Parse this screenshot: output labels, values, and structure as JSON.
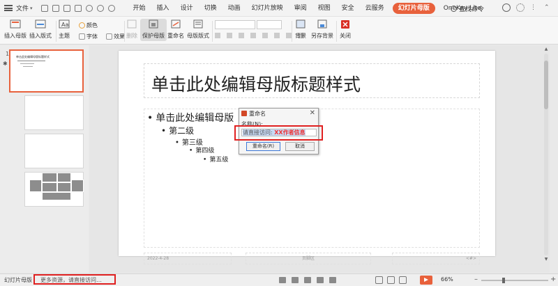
{
  "menubar": {
    "file_label": "文件",
    "tabs": [
      {
        "label": "开始",
        "active": false
      },
      {
        "label": "插入",
        "active": false
      },
      {
        "label": "设计",
        "active": false
      },
      {
        "label": "切换",
        "active": false
      },
      {
        "label": "动画",
        "active": false
      },
      {
        "label": "幻灯片放映",
        "active": false
      },
      {
        "label": "审阅",
        "active": false
      },
      {
        "label": "视图",
        "active": false
      },
      {
        "label": "安全",
        "active": false
      },
      {
        "label": "云服务",
        "active": false
      },
      {
        "label": "幻灯片母版",
        "active": true
      },
      {
        "label": "OneKey Lite",
        "active": false
      }
    ],
    "search_label": "查找命令"
  },
  "ribbon": {
    "insert_master": "插入母版",
    "insert_layout": "插入版式",
    "theme": "主题",
    "color": "颜色",
    "font": "字体",
    "effect": "效果",
    "delete": "删除",
    "protect_master": "保护母版",
    "rename": "重命名",
    "master_layout": "母版版式",
    "background": "背景",
    "save_bg": "另存背景",
    "close": "关闭"
  },
  "thumbnails": {
    "index": "1",
    "master_title": "单击此处编辑母版标题样式"
  },
  "slide": {
    "title": "单击此处编辑母版标题样式",
    "levels": [
      "单击此处编辑母版",
      "第二级",
      "第三级",
      "第四级",
      "第五级"
    ],
    "footer_date": "2022-4-28",
    "footer_center": "页脚区",
    "footer_num": "<#>"
  },
  "dialog": {
    "title": "重命名",
    "label": "名称(N):",
    "input_prefix": "请直接访问: ",
    "input_highlight": "XX作者信息",
    "ok_label": "重命名(R)",
    "cancel_label": "取消"
  },
  "statusbar": {
    "mode": "幻灯片母版",
    "resource": "更多资源，请直接访问…",
    "zoom": "66%"
  },
  "colors": {
    "accent": "#e8613c",
    "highlight": "#e02020"
  }
}
